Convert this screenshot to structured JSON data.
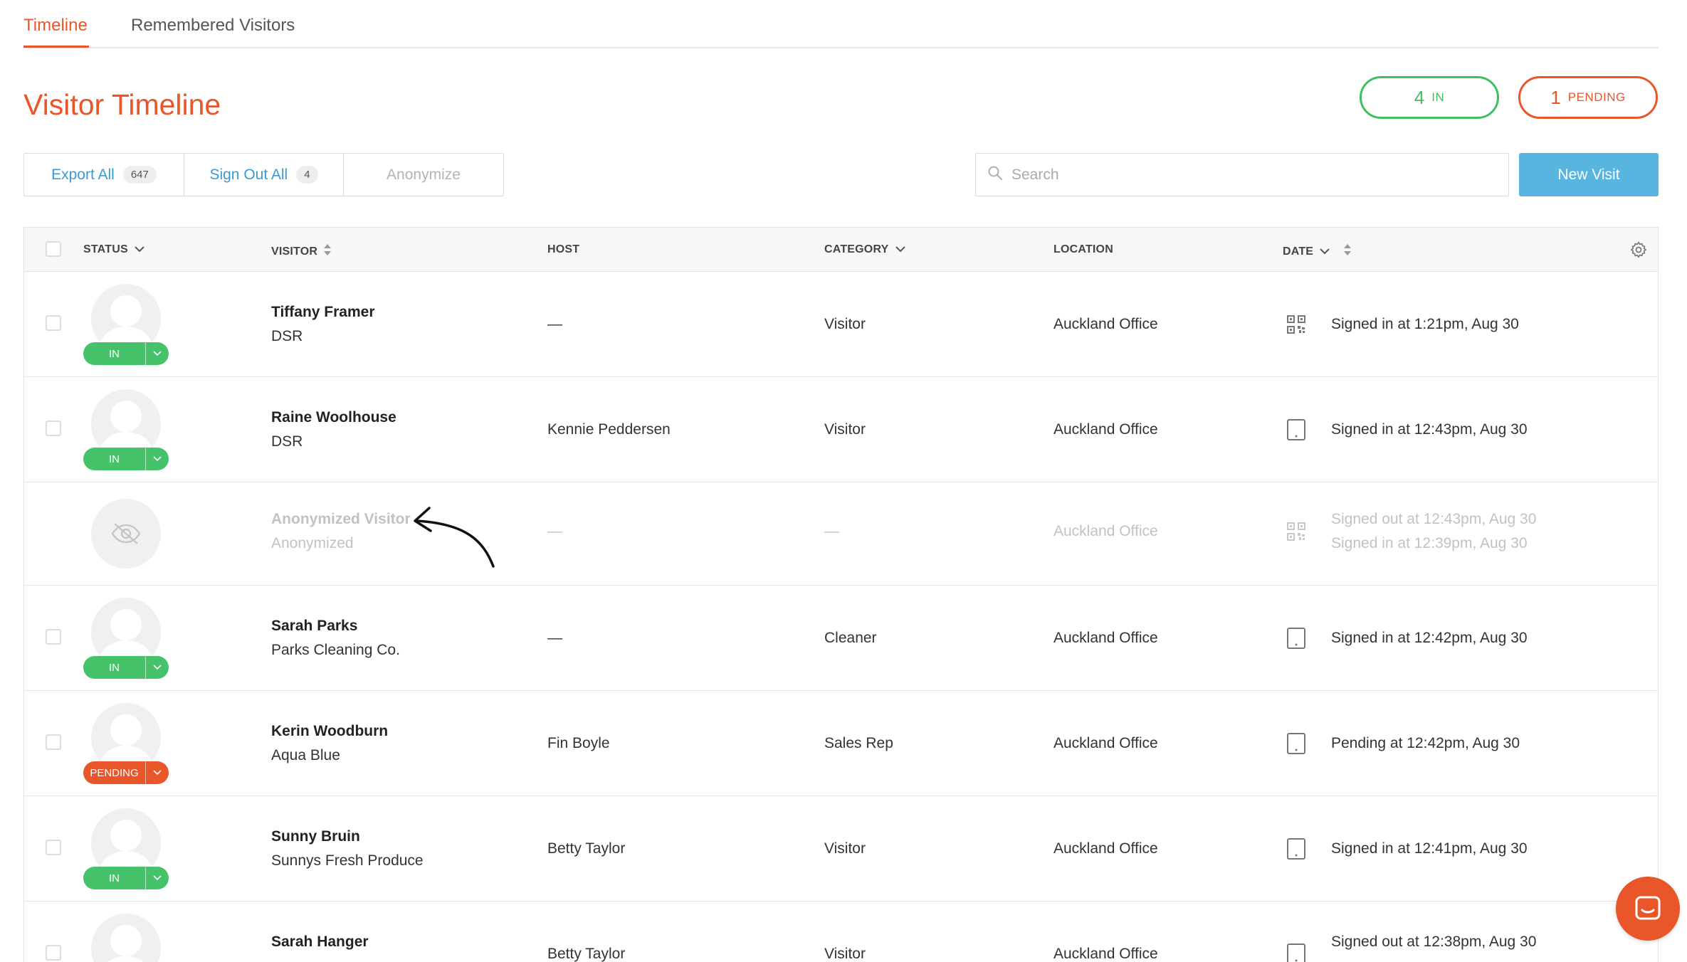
{
  "tabs": [
    {
      "label": "Timeline",
      "active": true
    },
    {
      "label": "Remembered Visitors",
      "active": false
    }
  ],
  "page_title": "Visitor Timeline",
  "counters": {
    "in": {
      "count": "4",
      "label": "IN"
    },
    "pending": {
      "count": "1",
      "label": "PENDING"
    }
  },
  "actions": {
    "export_all": {
      "label": "Export All",
      "badge": "647"
    },
    "sign_out_all": {
      "label": "Sign Out All",
      "badge": "4"
    },
    "anonymize": {
      "label": "Anonymize"
    }
  },
  "search": {
    "placeholder": "Search",
    "value": ""
  },
  "new_visit_label": "New Visit",
  "columns": {
    "status": "STATUS",
    "visitor": "VISITOR",
    "host": "HOST",
    "category": "CATEGORY",
    "location": "LOCATION",
    "date": "DATE"
  },
  "rows": [
    {
      "name": "Tiffany Framer",
      "company": "DSR",
      "host": "—",
      "category": "Visitor",
      "location": "Auckland Office",
      "device": "qr-code-icon",
      "status": "IN",
      "date1": "Signed in at 1:21pm, Aug 30",
      "date2": ""
    },
    {
      "name": "Raine Woolhouse",
      "company": "DSR",
      "host": "Kennie Peddersen",
      "category": "Visitor",
      "location": "Auckland Office",
      "device": "tablet-icon",
      "status": "IN",
      "date1": "Signed in at 12:43pm, Aug 30",
      "date2": ""
    },
    {
      "name": "Anonymized Visitor",
      "company": "Anonymized",
      "host": "—",
      "category": "—",
      "location": "Auckland Office",
      "device": "qr-code-icon",
      "status": "",
      "date1": "Signed out at 12:43pm, Aug 30",
      "date2": "Signed in at 12:39pm, Aug 30"
    },
    {
      "name": "Sarah Parks",
      "company": "Parks Cleaning Co.",
      "host": "—",
      "category": "Cleaner",
      "location": "Auckland Office",
      "device": "tablet-icon",
      "status": "IN",
      "date1": "Signed in at 12:42pm, Aug 30",
      "date2": ""
    },
    {
      "name": "Kerin Woodburn",
      "company": "Aqua Blue",
      "host": "Fin Boyle",
      "category": "Sales Rep",
      "location": "Auckland Office",
      "device": "tablet-icon",
      "status": "PENDING",
      "date1": "Pending at 12:42pm, Aug 30",
      "date2": ""
    },
    {
      "name": "Sunny Bruin",
      "company": "Sunnys Fresh Produce",
      "host": "Betty Taylor",
      "category": "Visitor",
      "location": "Auckland Office",
      "device": "tablet-icon",
      "status": "IN",
      "date1": "Signed in at 12:41pm, Aug 30",
      "date2": ""
    },
    {
      "name": "Sarah Hanger",
      "company": "",
      "host": "Betty Taylor",
      "category": "Visitor",
      "location": "Auckland Office",
      "device": "tablet-icon",
      "status": "",
      "date1": "Signed out at 12:38pm, Aug 30",
      "date2": ""
    }
  ],
  "colors": {
    "accent": "#e8562a",
    "green": "#46c26a",
    "blue": "#58b5e0",
    "link": "#3a9bd0"
  }
}
